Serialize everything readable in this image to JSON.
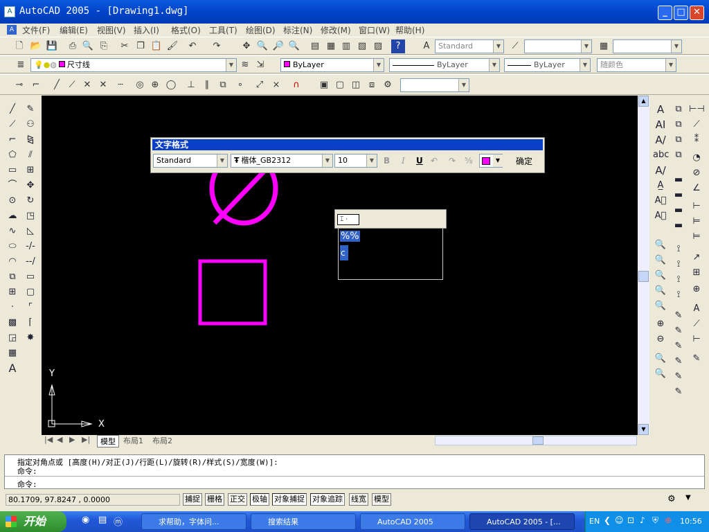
{
  "window": {
    "title": "AutoCAD 2005 - [Drawing1.dwg]",
    "minimize": "_",
    "maximize": "□",
    "close": "✕"
  },
  "menu": [
    "文件(F)",
    "编辑(E)",
    "视图(V)",
    "插入(I)",
    "格式(O)",
    "工具(T)",
    "绘图(D)",
    "标注(N)",
    "修改(M)",
    "窗口(W)",
    "帮助(H)"
  ],
  "toolbar_styles": {
    "text_style": "Standard",
    "dim_style": "",
    "table_style": ""
  },
  "layers": {
    "current_layer": "尺寸线",
    "color": "ByLayer",
    "linetype": "ByLayer",
    "lineweight": "ByLayer",
    "plot_style": "随颜色"
  },
  "text_format": {
    "title": "文字格式",
    "style": "Standard",
    "font": "楷体_GB2312",
    "height": "10",
    "bold": "B",
    "italic": "I",
    "underline": "U",
    "ok": "确定"
  },
  "edit_text": {
    "selection_line1": "%%",
    "selection_line2": "c"
  },
  "ucs": {
    "x_label": "X",
    "y_label": "Y"
  },
  "tabs": {
    "model": "模型",
    "layout1": "布局1",
    "layout2": "布局2"
  },
  "command": {
    "line1": "指定对角点或 [高度(H)/对正(J)/行距(L)/旋转(R)/样式(S)/宽度(W)]:",
    "line2": "命令:",
    "line3": "命令:"
  },
  "status": {
    "coords": "80.1709,  97.8247 , 0.0000",
    "buttons": [
      "捕捉",
      "栅格",
      "正交",
      "极轴",
      "对象捕捉",
      "对象追踪",
      "线宽",
      "模型"
    ]
  },
  "taskbar": {
    "start": "开始",
    "tasks": [
      "求帮助，字体问...",
      "搜索结果",
      "AutoCAD 2005",
      "AutoCAD 2005 - [..."
    ],
    "lang": "EN",
    "time": "10:56"
  },
  "colors": {
    "magenta": "#ff00ff",
    "canvas": "#000000",
    "title_blue": "#0244c8"
  }
}
